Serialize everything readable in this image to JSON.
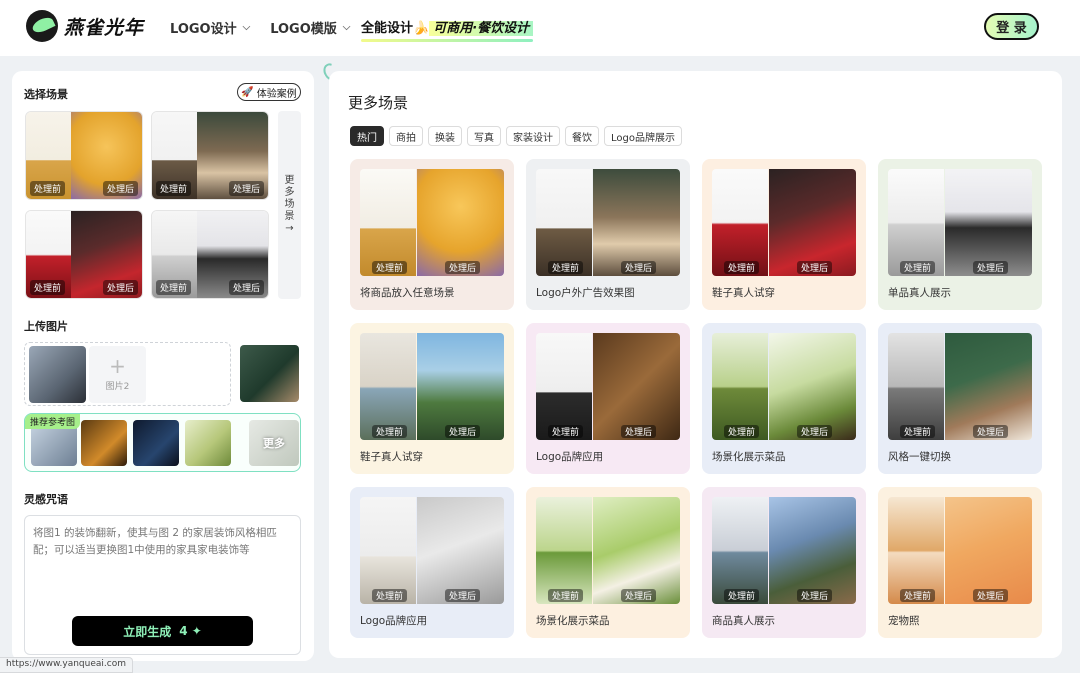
{
  "header": {
    "logo_text": "燕雀光年",
    "nav": [
      {
        "label": "LOGO设计"
      },
      {
        "label": "LOGO模版"
      }
    ],
    "special_nav": {
      "label": "全能设计",
      "highlight": "可商用·餐饮设计"
    },
    "login_label": "登 录"
  },
  "left": {
    "scene_title": "选择场景",
    "case_button": "体验案例",
    "more_scenes": [
      "更",
      "多",
      "场",
      "景",
      "→"
    ],
    "before_label": "处理前",
    "after_label": "处理后",
    "upload_title": "上传图片",
    "upload_add_label": "图片2",
    "rec_tag": "推荐参考图",
    "rec_more": "更多",
    "prompt_title": "灵感咒语",
    "prompt_text": "将图1 的装饰翻新，使其与图 2 的家居装饰风格相匹配；可以适当更换图1中使用的家具家电装饰等",
    "generate_label": "立即生成",
    "generate_cost": "4 ✦"
  },
  "right": {
    "title": "更多场景",
    "filters": [
      "热门",
      "商拍",
      "换装",
      "写真",
      "家装设计",
      "餐饮",
      "Logo品牌展示"
    ],
    "active_filter": 0,
    "before_label": "处理前",
    "after_label": "处理后",
    "cards": [
      {
        "label": "将商品放入任意场景",
        "bg": "#f6ebe6"
      },
      {
        "label": "Logo户外广告效果图",
        "bg": "#eef0f2"
      },
      {
        "label": "鞋子真人试穿",
        "bg": "#fdefe1"
      },
      {
        "label": "单品真人展示",
        "bg": "#ebf2e6"
      },
      {
        "label": "鞋子真人试穿",
        "bg": "#fcf4e2"
      },
      {
        "label": "Logo品牌应用",
        "bg": "#f7e9f4"
      },
      {
        "label": "场景化展示菜品",
        "bg": "#e8edf7"
      },
      {
        "label": "风格一键切换",
        "bg": "#e8edf7"
      },
      {
        "label": "Logo品牌应用",
        "bg": "#e8edf7"
      },
      {
        "label": "场景化展示菜品",
        "bg": "#fdf0e0"
      },
      {
        "label": "商品真人展示",
        "bg": "#f5e9f3"
      },
      {
        "label": "宠物照",
        "bg": "#fcf1e0"
      }
    ]
  },
  "status_url": "https://www.yanqueai.com"
}
